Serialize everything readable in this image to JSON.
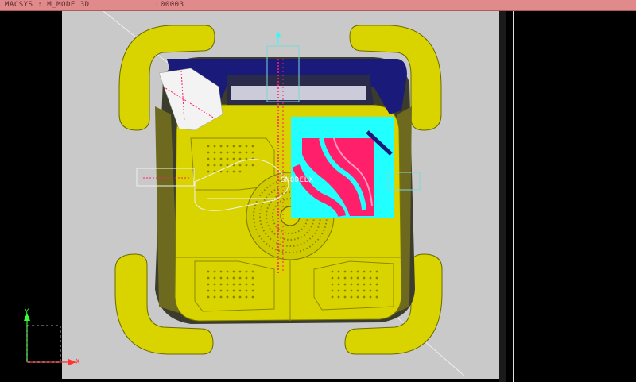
{
  "titlebar": {
    "mode": "MACSYS : M_MODE 3D",
    "layer": "L00003"
  },
  "viewport": {
    "origin_label": "SNODELX",
    "axis_x": "X",
    "axis_y": "Y"
  },
  "colors": {
    "titlebar": "#e08a8c",
    "background": "#000000",
    "mold_plate": "#c9c9c9",
    "part_yellow": "#d9d400",
    "part_shadow": "#3c3c2c",
    "highlight_magenta": "#ff1f6a",
    "highlight_cyan": "#22ffff",
    "highlight_navy": "#1a1a7a"
  }
}
